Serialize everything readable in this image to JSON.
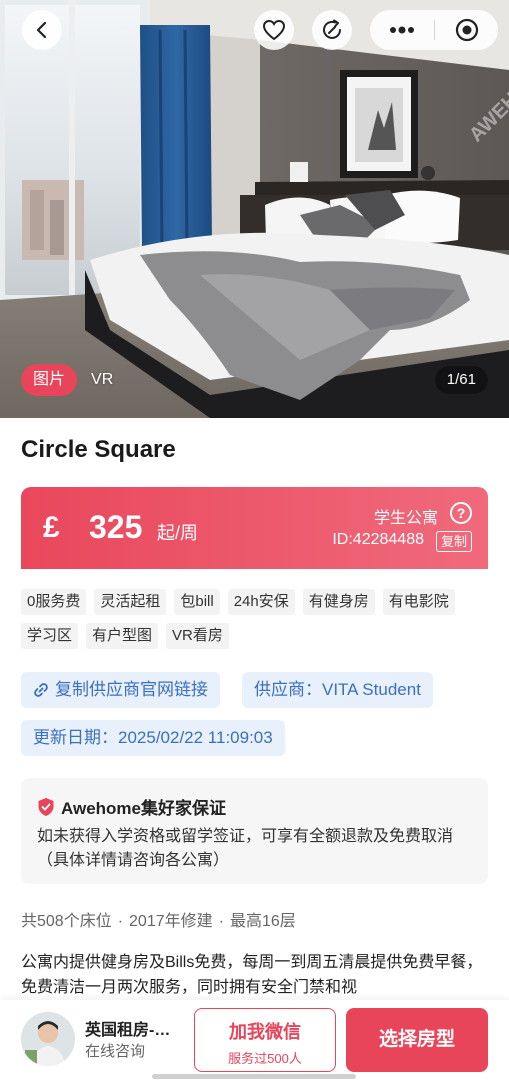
{
  "hero": {
    "photo_tab": "图片",
    "vr_tab": "VR",
    "counter": "1/61",
    "watermark": "AWEHOME"
  },
  "title": "Circle Square",
  "price": {
    "currency": "£",
    "value": "325",
    "unit": "起/周",
    "type": "学生公寓",
    "id": "ID:42284488",
    "copy": "复制",
    "help": "?"
  },
  "tags": [
    "0服务费",
    "灵活起租",
    "包bill",
    "24h安保",
    "有健身房",
    "有电影院",
    "学习区",
    "有户型图",
    "VR看房"
  ],
  "chips": {
    "copy_link": "复制供应商官网链接",
    "supplier": "供应商：VITA Student",
    "updated": "更新日期：2025/02/22 11:09:03"
  },
  "guarantee": {
    "title": "Awehome集好家保证",
    "body": "如未获得入学资格或留学签证，可享有全额退款及免费取消（具体详情请咨询各公寓）"
  },
  "stats": {
    "beds": "共508个床位",
    "year": "2017年修建",
    "floors": "最高16层",
    "sep": "·"
  },
  "description": "公寓内提供健身房及Bills免费，每周一到周五清晨提供免费早餐，免费清洁一月两次服务，同时拥有安全门禁和视",
  "bottom": {
    "agent_name": "英国租房-…",
    "agent_status": "在线咨询",
    "wechat_main": "加我微信",
    "wechat_sub": "服务过500人",
    "choose": "选择房型"
  },
  "colors": {
    "accent": "#e8445a",
    "chip_bg": "#e8f0fb",
    "chip_text": "#3b6fc0"
  }
}
